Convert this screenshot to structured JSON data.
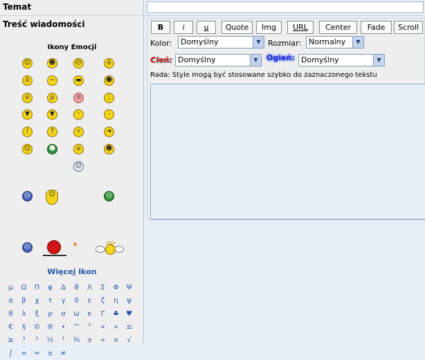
{
  "subject_label": "Temat",
  "body_label": "Treść wiadomości",
  "emoticons_title": "Ikony Emocji",
  "more_icons_label": "Więcej Ikon",
  "toolbar": {
    "bold": "B",
    "italic": "i",
    "underline": "u",
    "quote": "Quote",
    "img": "Img",
    "url": "URL",
    "center": "Center",
    "fade": "Fade",
    "scroll": "Scroll"
  },
  "color_label": "Kolor:",
  "color_value": "Domyślny",
  "size_label": "Rozmiar:",
  "size_value": "Normalny",
  "shadow_label": "Cień:",
  "shadow_value": "Domyślny",
  "glow_label": "Ogień:",
  "glow_value": "Domyślny",
  "hint": "Rada: Style mogą być stosowane szybko do zaznaczonego tekstu",
  "emoticons": [
    "smile",
    "grin",
    "sad",
    "surprised",
    "shocked",
    "confused",
    "cool",
    "laugh",
    "mad",
    "razz",
    "embarrassed",
    "wink",
    "exclaim",
    "question",
    "idea",
    "arrow",
    "neutral",
    "mrgreen",
    "rolleyes",
    "twisted"
  ],
  "special_chars": [
    "μ",
    "Ω",
    "Π",
    "φ",
    "Δ",
    "θ",
    "Λ",
    "Σ",
    "Φ",
    "Ψ",
    "α",
    "β",
    "χ",
    "τ",
    "γ",
    "δ",
    "ε",
    "ζ",
    "η",
    "ψ",
    "θ",
    "λ",
    "ξ",
    "ρ",
    "σ",
    "ω",
    "κ",
    "Γ",
    "♣",
    "♥",
    "€",
    "§",
    "©",
    "®",
    "•",
    "™",
    "°",
    "«",
    "»",
    "≤",
    "≥",
    "³",
    "²",
    "½",
    "¹",
    "¾",
    "±",
    "÷",
    "×",
    "√",
    "∫",
    "∞",
    "≈",
    "±",
    "≠"
  ]
}
